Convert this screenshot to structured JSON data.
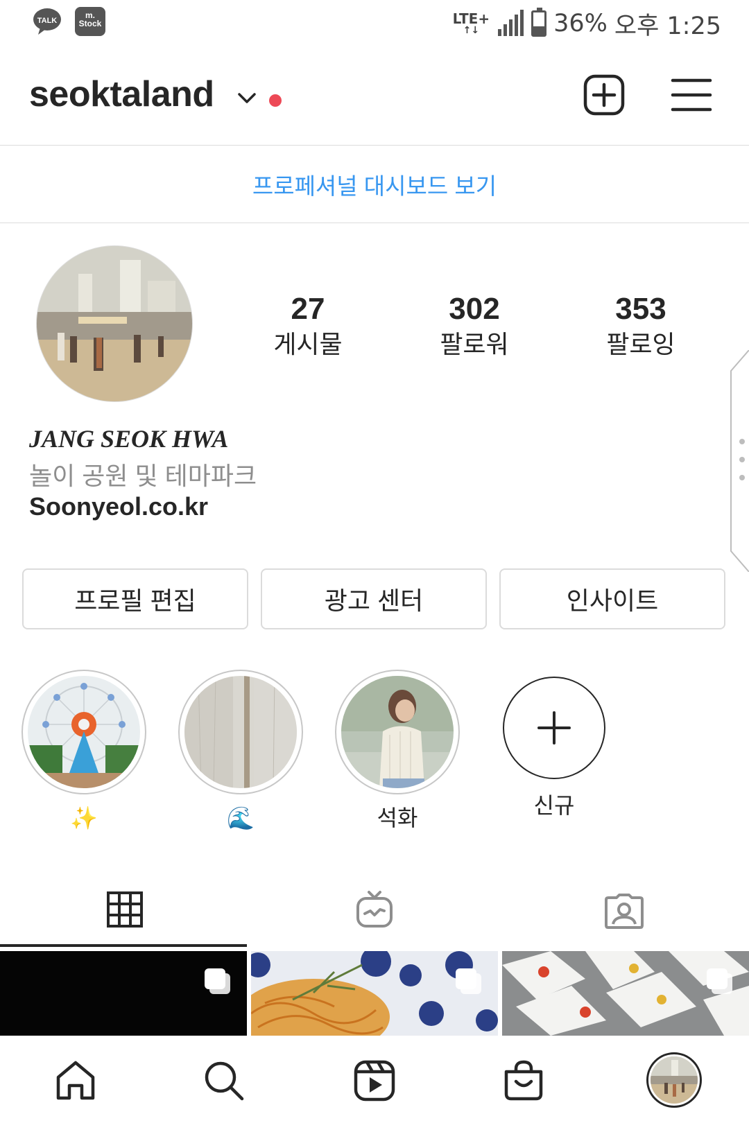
{
  "status_bar": {
    "apps": [
      "TALK",
      "m.\nStock"
    ],
    "network": "LTE+",
    "battery": "36%",
    "time": "오후 1:25"
  },
  "header": {
    "username": "seoktaland",
    "add_icon": "plus-square-icon",
    "menu_icon": "hamburger-menu-icon"
  },
  "dashboard_link": "프로페셔널 대시보드 보기",
  "profile": {
    "stats": [
      {
        "value": "27",
        "label": "게시물"
      },
      {
        "value": "302",
        "label": "팔로워"
      },
      {
        "value": "353",
        "label": "팔로잉"
      }
    ],
    "full_name": "JANG SEOK HWA",
    "category": "놀이 공원 및 테마파크",
    "website": "Soonyeol.co.kr"
  },
  "buttons": {
    "edit_profile": "프로필 편집",
    "ad_center": "광고 센터",
    "insights": "인사이트"
  },
  "highlights": [
    {
      "label": "✨",
      "image": "ferris-wheel"
    },
    {
      "label": "🌊",
      "image": "wood-texture"
    },
    {
      "label": "석화",
      "image": "portrait"
    },
    {
      "label": "신규",
      "image": "new"
    }
  ],
  "tabs": [
    "grid-icon",
    "igtv-icon",
    "tagged-icon"
  ],
  "bottom_nav": [
    "home-icon",
    "search-icon",
    "reels-icon",
    "shop-icon",
    "profile-avatar"
  ],
  "colors": {
    "accent_link": "#3897f0",
    "notification_dot": "#ed4956",
    "text": "#262626",
    "secondary_text": "#8e8e8e",
    "border": "#dbdbdb"
  }
}
